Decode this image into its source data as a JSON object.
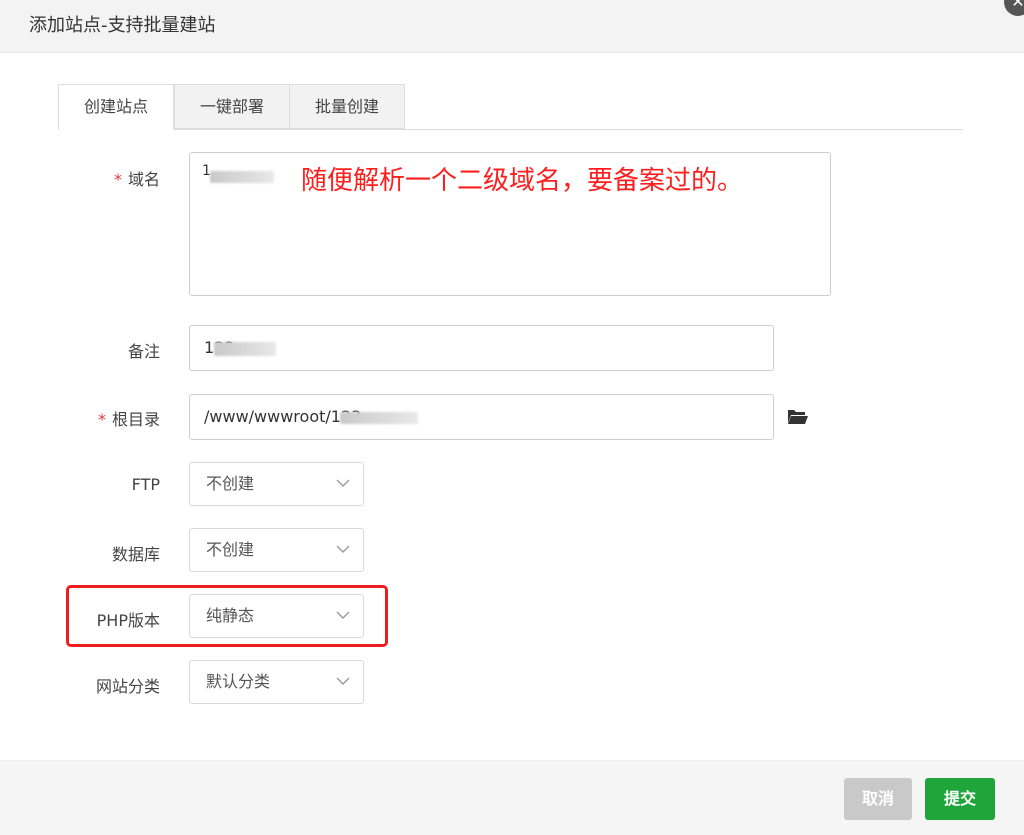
{
  "dialog": {
    "title": "添加站点-支持批量建站",
    "close_glyph": "✕"
  },
  "tabs": [
    {
      "label": "创建站点",
      "active": true
    },
    {
      "label": "一键部署",
      "active": false
    },
    {
      "label": "批量创建",
      "active": false
    }
  ],
  "form": {
    "domain": {
      "required_mark": "*",
      "label": "域名",
      "value": "1"
    },
    "annotation": "随便解析一个二级域名，要备案过的。",
    "remark": {
      "label": "备注",
      "value": "123.com"
    },
    "root": {
      "required_mark": "*",
      "label": "根目录",
      "value": "/www/wwwroot/123"
    },
    "ftp": {
      "label": "FTP",
      "value": "不创建"
    },
    "database": {
      "label": "数据库",
      "value": "不创建"
    },
    "php": {
      "label": "PHP版本",
      "value": "纯静态"
    },
    "category": {
      "label": "网站分类",
      "value": "默认分类"
    }
  },
  "footer": {
    "cancel_label": "取消",
    "submit_label": "提交"
  },
  "colors": {
    "accent_green": "#20a53a",
    "annotation_red": "#ff1e1e",
    "required_red": "#e03b3b"
  },
  "icons": {
    "folder": "folder-open-icon",
    "chevron": "chevron-down-icon",
    "close": "close-icon"
  }
}
